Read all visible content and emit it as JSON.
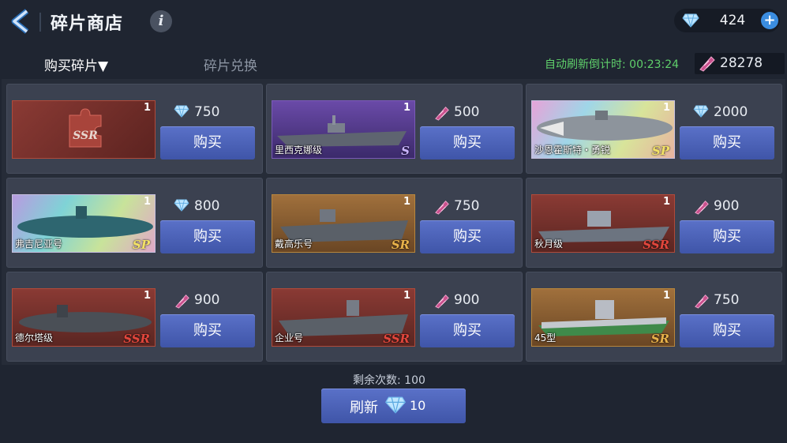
{
  "header": {
    "title": "碎片商店",
    "info_label": "i",
    "diamonds": "424",
    "plus_label": "+"
  },
  "tabs": {
    "buy_fragments": "购买碎片▼",
    "exchange_fragments": "碎片兑换"
  },
  "status": {
    "refresh_countdown": "自动刷新倒计时: 00:23:24",
    "fragment_balance": "28278"
  },
  "colors": {
    "accent_blue": "#4a62b8",
    "timer_green": "#5fd06b",
    "ssr_red": "#d9463c",
    "sr_gold": "#d8a13c",
    "s_purple": "#9b7fe8"
  },
  "shop_items": [
    {
      "name": "",
      "rank": "SSR",
      "count": "1",
      "price": "750",
      "currency": "diamond-icon",
      "buy_label": "购买",
      "theme": "ssr-fragment"
    },
    {
      "name": "里西克娜级",
      "rank": "S",
      "count": "1",
      "price": "500",
      "currency": "fragment-icon",
      "buy_label": "购买",
      "theme": "purple"
    },
    {
      "name": "沙恩霍斯特・勇锐",
      "rank": "SP",
      "count": "1",
      "price": "2000",
      "currency": "diamond-icon",
      "buy_label": "购买",
      "theme": "rainbow"
    },
    {
      "name": "弗吉尼亚号",
      "rank": "SP",
      "count": "1",
      "price": "800",
      "currency": "diamond-icon",
      "buy_label": "购买",
      "theme": "rainbow"
    },
    {
      "name": "戴高乐号",
      "rank": "SR",
      "count": "1",
      "price": "750",
      "currency": "fragment-icon",
      "buy_label": "购买",
      "theme": "gold"
    },
    {
      "name": "秋月级",
      "rank": "SSR",
      "count": "1",
      "price": "900",
      "currency": "fragment-icon",
      "buy_label": "购买",
      "theme": "red"
    },
    {
      "name": "德尔塔级",
      "rank": "SSR",
      "count": "1",
      "price": "900",
      "currency": "fragment-icon",
      "buy_label": "购买",
      "theme": "red"
    },
    {
      "name": "企业号",
      "rank": "SSR",
      "count": "1",
      "price": "900",
      "currency": "fragment-icon",
      "buy_label": "购买",
      "theme": "red"
    },
    {
      "name": "45型",
      "rank": "SR",
      "count": "1",
      "price": "750",
      "currency": "fragment-icon",
      "buy_label": "购买",
      "theme": "gold"
    }
  ],
  "footer": {
    "remaining": "剩余次数: 100",
    "refresh_label": "刷新",
    "refresh_cost": "10"
  }
}
